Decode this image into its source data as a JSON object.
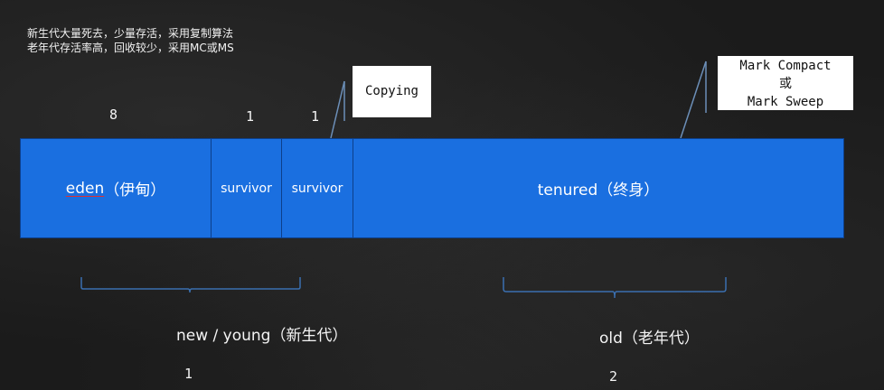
{
  "notes": {
    "line1": "新生代大量死去，少量存活，采用复制算法",
    "line2": "老年代存活率高，回收较少，采用MC或MS"
  },
  "ratios": {
    "eden": "8",
    "survivor_from": "1",
    "survivor_to": "1"
  },
  "callouts": {
    "copying": "Copying",
    "mark_compact": "Mark Compact",
    "or": "或",
    "mark_sweep": "Mark Sweep"
  },
  "segments": {
    "eden_word": "eden",
    "eden_cn": "（伊甸）",
    "survivor_1": "survivor",
    "survivor_2": "survivor",
    "tenured": "tenured（终身）"
  },
  "groups": {
    "young_label": "new / young（新生代）",
    "young_ratio": "1",
    "old_label": "old（老年代）",
    "old_ratio": "2"
  },
  "colors": {
    "bar": "#1a6fe0",
    "background": "#1b1b1b"
  }
}
